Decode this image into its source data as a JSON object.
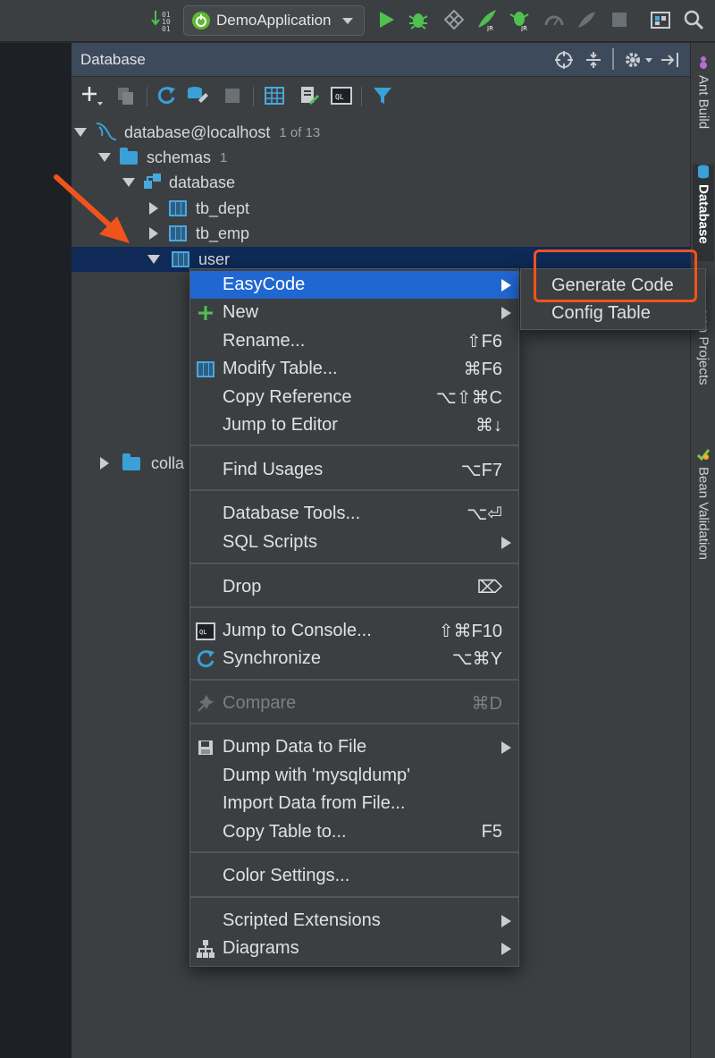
{
  "toolbar": {
    "run_config": "DemoApplication",
    "binary_badge": "01 01"
  },
  "panel": {
    "title": "Database"
  },
  "tree": [
    {
      "label": "database@localhost",
      "hint": "1 of 13"
    },
    {
      "label": "schemas",
      "hint": "1"
    },
    {
      "label": "database",
      "hint": ""
    },
    {
      "label": "tb_dept",
      "hint": ""
    },
    {
      "label": "tb_emp",
      "hint": ""
    },
    {
      "label": "user",
      "hint": ""
    },
    {
      "label": "colla",
      "hint": ""
    }
  ],
  "context_menu": {
    "items": [
      {
        "label": "EasyCode",
        "shortcut": "",
        "icon": "none",
        "submenu": true,
        "highlighted": true
      },
      {
        "label": "New",
        "shortcut": "",
        "icon": "plus-icon",
        "submenu": true
      },
      {
        "label": "Rename...",
        "shortcut": "⇧F6",
        "icon": "none"
      },
      {
        "label": "Modify Table...",
        "shortcut": "⌘F6",
        "icon": "table-icon"
      },
      {
        "label": "Copy Reference",
        "shortcut": "⌥⇧⌘C",
        "icon": "none"
      },
      {
        "label": "Jump to Editor",
        "shortcut": "⌘↓",
        "icon": "none"
      },
      {
        "label": "Find Usages",
        "shortcut": "⌥F7",
        "icon": "none"
      },
      {
        "label": "Database Tools...",
        "shortcut": "⌥⏎",
        "icon": "none"
      },
      {
        "label": "SQL Scripts",
        "shortcut": "",
        "icon": "none",
        "submenu": true
      },
      {
        "label": "Drop",
        "shortcut": "⌦",
        "icon": "none"
      },
      {
        "label": "Jump to Console...",
        "shortcut": "⇧⌘F10",
        "icon": "console-icon"
      },
      {
        "label": "Synchronize",
        "shortcut": "⌥⌘Y",
        "icon": "sync-icon"
      },
      {
        "label": "Compare",
        "shortcut": "⌘D",
        "icon": "compare-icon",
        "disabled": true
      },
      {
        "label": "Dump Data to File",
        "shortcut": "",
        "icon": "floppy-icon",
        "submenu": true
      },
      {
        "label": "Dump with 'mysqldump'",
        "shortcut": "",
        "icon": "none"
      },
      {
        "label": "Import Data from File...",
        "shortcut": "",
        "icon": "none"
      },
      {
        "label": "Copy Table to...",
        "shortcut": "F5",
        "icon": "none"
      },
      {
        "label": "Color Settings...",
        "shortcut": "",
        "icon": "none"
      },
      {
        "label": "Scripted Extensions",
        "shortcut": "",
        "icon": "none",
        "submenu": true
      },
      {
        "label": "Diagrams",
        "shortcut": "",
        "icon": "diagram-icon",
        "submenu": true
      }
    ]
  },
  "submenu": {
    "items": [
      "Generate Code",
      "Config Table"
    ]
  },
  "side_tabs": {
    "ant_build": "Ant Build",
    "database": "Database",
    "maven": "ven Projects",
    "bean_validation": "Bean Validation"
  },
  "colors": {
    "highlight": "#2167d1",
    "annotation": "#f0531c",
    "selection": "#0f2a57"
  }
}
